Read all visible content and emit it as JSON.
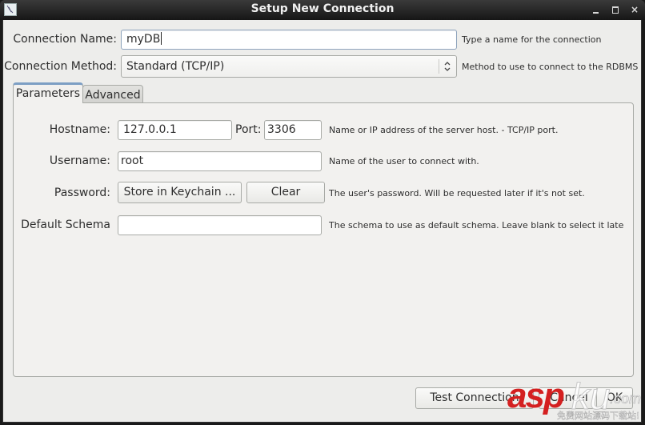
{
  "window": {
    "title": "Setup New Connection",
    "controls": {
      "minimize": "minimize",
      "maximize": "maximize",
      "close": "×"
    }
  },
  "connection_name": {
    "label": "Connection Name:",
    "value": "myDB",
    "hint": "Type a name for the connection"
  },
  "connection_method": {
    "label": "Connection Method:",
    "selected": "Standard (TCP/IP)",
    "hint": "Method to use to connect to the RDBMS"
  },
  "tabs": [
    {
      "label": "Parameters",
      "active": true
    },
    {
      "label": "Advanced",
      "active": false
    }
  ],
  "parameters": {
    "hostname": {
      "label": "Hostname:",
      "value": "127.0.0.1"
    },
    "port": {
      "label": "Port:",
      "value": "3306"
    },
    "host_hint": "Name or IP address of the server host. - TCP/IP port.",
    "username": {
      "label": "Username:",
      "value": "root",
      "hint": "Name of the user to connect with."
    },
    "password": {
      "label": "Password:",
      "store_button": "Store in Keychain ...",
      "clear_button": "Clear",
      "hint": "The user's password. Will be requested later if it's not set."
    },
    "default_schema": {
      "label": "Default Schema",
      "value": "",
      "hint": "The schema to use as default schema. Leave blank to select it late"
    }
  },
  "footer": {
    "test_connection": "Test Connection",
    "cancel": "Cancel",
    "ok": "OK"
  },
  "watermark": {
    "brand_red": "asp",
    "brand_white": "ku",
    "domain": ".com",
    "tagline": "免费网站源码下载站!"
  },
  "colors": {
    "titlebar": "#1e1e1e",
    "window_bg": "#ededeb",
    "tab_accent": "#7d9fc4",
    "watermark_red": "#d42020"
  }
}
